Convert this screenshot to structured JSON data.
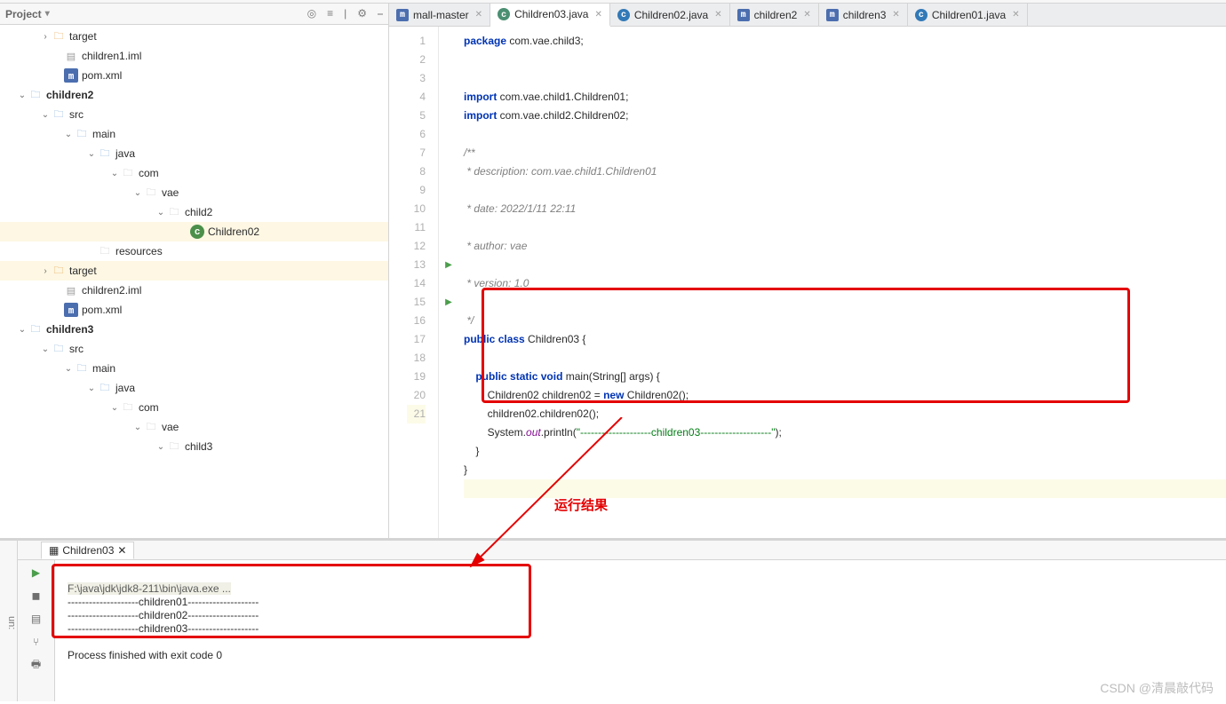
{
  "toolbar": {
    "title": "Project",
    "icons": [
      "target-icon",
      "settings-icon",
      "collapse-icon",
      "gear-icon",
      "hide-icon"
    ]
  },
  "tree": [
    {
      "indent": 44,
      "chev": ">",
      "ico": "folder-orange",
      "label": "target",
      "folderType": "folder-orange"
    },
    {
      "indent": 58,
      "chev": "",
      "ico": "iml",
      "label": "children1.iml"
    },
    {
      "indent": 58,
      "chev": "",
      "ico": "m",
      "label": "pom.xml"
    },
    {
      "indent": 18,
      "chev": "v",
      "ico": "folder-blue",
      "label": "children2",
      "bold": true
    },
    {
      "indent": 44,
      "chev": "v",
      "ico": "folder-blue",
      "label": "src"
    },
    {
      "indent": 70,
      "chev": "v",
      "ico": "folder-blue",
      "label": "main"
    },
    {
      "indent": 96,
      "chev": "v",
      "ico": "folder-blue",
      "label": "java"
    },
    {
      "indent": 122,
      "chev": "v",
      "ico": "folder-grey",
      "label": "com"
    },
    {
      "indent": 148,
      "chev": "v",
      "ico": "folder-grey",
      "label": "vae"
    },
    {
      "indent": 174,
      "chev": "v",
      "ico": "folder-grey",
      "label": "child2"
    },
    {
      "indent": 200,
      "chev": "",
      "ico": "class",
      "label": "Children02",
      "sel": true
    },
    {
      "indent": 96,
      "chev": "",
      "ico": "folder-grey",
      "label": "resources"
    },
    {
      "indent": 44,
      "chev": ">",
      "ico": "folder-orange",
      "label": "target",
      "sel": true,
      "folderType": "folder-orange"
    },
    {
      "indent": 58,
      "chev": "",
      "ico": "iml",
      "label": "children2.iml"
    },
    {
      "indent": 58,
      "chev": "",
      "ico": "m",
      "label": "pom.xml"
    },
    {
      "indent": 18,
      "chev": "v",
      "ico": "folder-blue",
      "label": "children3",
      "bold": true
    },
    {
      "indent": 44,
      "chev": "v",
      "ico": "folder-blue",
      "label": "src"
    },
    {
      "indent": 70,
      "chev": "v",
      "ico": "folder-blue",
      "label": "main"
    },
    {
      "indent": 96,
      "chev": "v",
      "ico": "folder-blue",
      "label": "java"
    },
    {
      "indent": 122,
      "chev": "v",
      "ico": "folder-grey",
      "label": "com"
    },
    {
      "indent": 148,
      "chev": "v",
      "ico": "folder-grey",
      "label": "vae"
    },
    {
      "indent": 174,
      "chev": "v",
      "ico": "folder-grey",
      "label": "child3"
    }
  ],
  "tabs": [
    {
      "ico": "m",
      "label": "mall-master"
    },
    {
      "ico": "c",
      "label": "Children03.java",
      "active": true
    },
    {
      "ico": "cb",
      "label": "Children02.java"
    },
    {
      "ico": "m",
      "label": "children2"
    },
    {
      "ico": "m",
      "label": "children3"
    },
    {
      "ico": "cb",
      "label": "Children01.java"
    }
  ],
  "code": {
    "lines": 21,
    "pkg_kw": "package",
    "pkg": " com.vae.child3;",
    "imp_kw": "import",
    "imp1": " com.vae.child1.Children01;",
    "imp2": " com.vae.child2.Children02;",
    "cmt_open": "/**",
    "cmt_desc": " * description: com.vae.child1.Children01 ",
    "br": "<br>",
    "cmt_date": " * date: 2022/1/11 22:11 ",
    "cmt_auth": " * author: vae ",
    "cmt_ver": " * version: 1.0 ",
    "cmt_close": " */",
    "pub": "public",
    "cls_kw": "class",
    "cls": "Children03",
    "ob": " {",
    "static": "static",
    "void": "void",
    "main": "main",
    "sig": "(String[] args) {",
    "l16": "        Children02 children02 = ",
    "new": "new",
    "l16b": " Children02();",
    "l17": "        children02.children02();",
    "l18a": "        System.",
    "out": "out",
    "l18b": ".println(",
    "str": "\"--------------------",
    "green": "children03",
    "str2": "--------------------\"",
    "l18c": ");",
    "cb": "    }",
    "cb2": "}"
  },
  "label_result": "运行结果",
  "run": {
    "tab": "Children03",
    "cmd": "F:\\java\\jdk\\jdk8-211\\bin\\java.exe ...",
    "l1": "--------------------children01--------------------",
    "l2": "--------------------children02--------------------",
    "l3": "--------------------children03--------------------",
    "exit": "Process finished with exit code 0"
  },
  "watermark": "CSDN @清晨敲代码",
  "run_strip": "un:"
}
